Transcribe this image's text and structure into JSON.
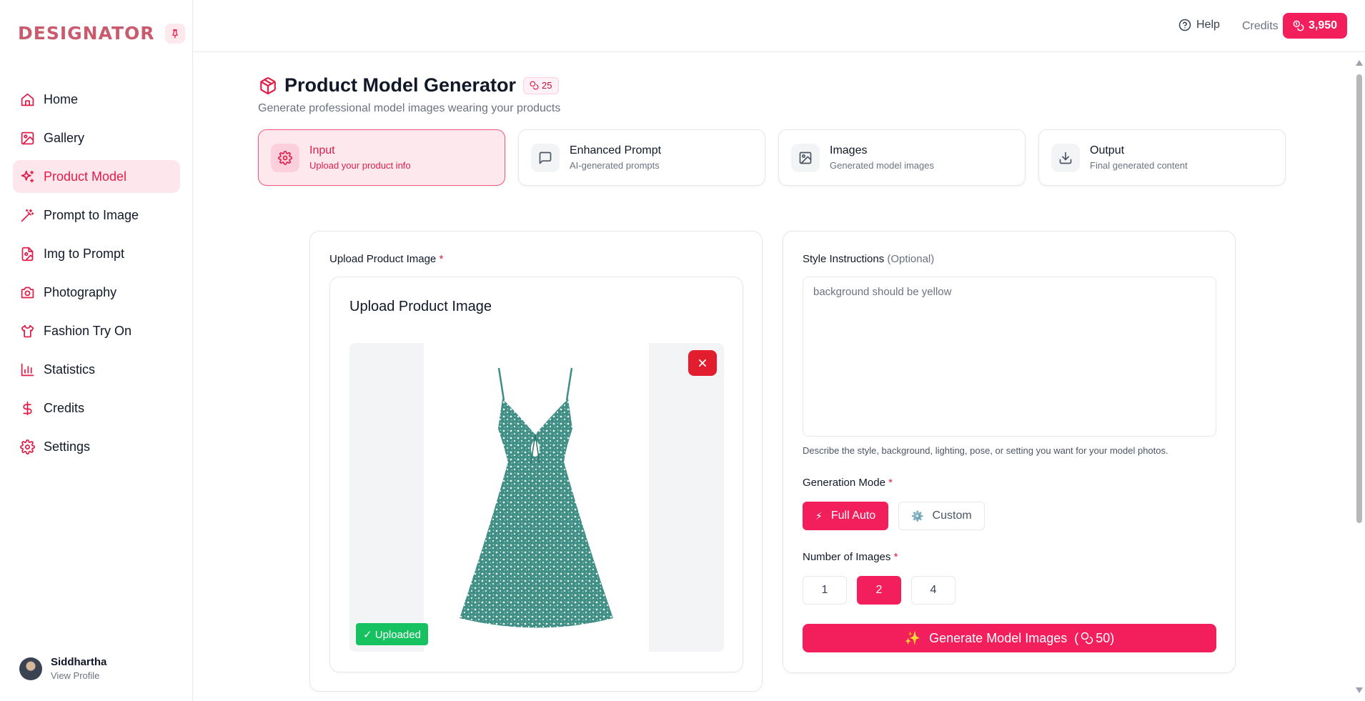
{
  "sidebar": {
    "logo": "DESIGNATOR",
    "items": [
      {
        "label": "Home",
        "icon": "home-icon"
      },
      {
        "label": "Gallery",
        "icon": "gallery-icon"
      },
      {
        "label": "Product Model",
        "icon": "sparkles-icon",
        "active": true
      },
      {
        "label": "Prompt to Image",
        "icon": "wand-icon"
      },
      {
        "label": "Img to Prompt",
        "icon": "file-image-icon"
      },
      {
        "label": "Photography",
        "icon": "camera-icon"
      },
      {
        "label": "Fashion Try On",
        "icon": "shirt-icon"
      },
      {
        "label": "Statistics",
        "icon": "bar-chart-icon"
      },
      {
        "label": "Credits",
        "icon": "dollar-icon"
      },
      {
        "label": "Settings",
        "icon": "gear-icon"
      }
    ],
    "profile": {
      "name": "Siddhartha",
      "link": "View Profile"
    }
  },
  "topbar": {
    "help_label": "Help",
    "credits_label": "Credits",
    "credits_value": "3,950"
  },
  "page": {
    "title": "Product Model Generator",
    "cost": "25",
    "subtitle": "Generate professional model images wearing your products"
  },
  "steps": [
    {
      "title": "Input",
      "subtitle": "Upload your product info",
      "icon": "gear-icon",
      "active": true
    },
    {
      "title": "Enhanced Prompt",
      "subtitle": "AI-generated prompts",
      "icon": "message-icon"
    },
    {
      "title": "Images",
      "subtitle": "Generated model images",
      "icon": "image-icon"
    },
    {
      "title": "Output",
      "subtitle": "Final generated content",
      "icon": "download-icon"
    }
  ],
  "upload": {
    "label": "Upload Product Image",
    "required_mark": "*",
    "box_title": "Upload Product Image",
    "status": "✓ Uploaded"
  },
  "style": {
    "label": "Style Instructions",
    "optional": "(Optional)",
    "value": "background should be yellow",
    "hint": "Describe the style, background, lighting, pose, or setting you want for your model photos."
  },
  "generation_mode": {
    "label": "Generation Mode",
    "required_mark": "*",
    "options": [
      {
        "label": "Full Auto",
        "emoji": "⚡",
        "active": true
      },
      {
        "label": "Custom",
        "emoji": "⚙️",
        "active": false
      }
    ]
  },
  "num_images": {
    "label": "Number of Images",
    "required_mark": "*",
    "options": [
      "1",
      "2",
      "4"
    ],
    "selected": "2"
  },
  "generate": {
    "label": "Generate Model Images",
    "emoji": "✨",
    "cost_open": "(",
    "cost": "50",
    "cost_close": ")"
  },
  "colors": {
    "accent": "#f31e5c",
    "accent_text": "#e11d48",
    "active_bg": "#fde8ee",
    "success": "#16c25f",
    "danger": "#e11d2e"
  }
}
